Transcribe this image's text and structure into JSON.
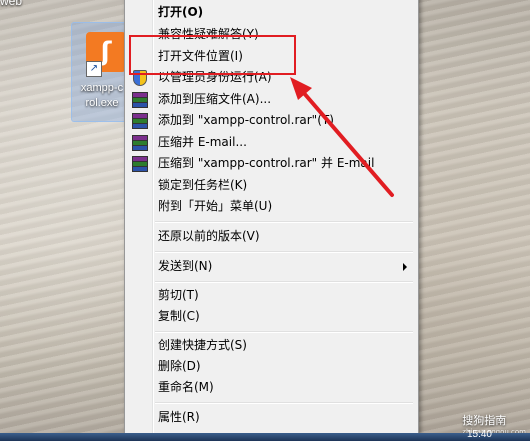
{
  "desktop": {
    "partial_label_top": "web",
    "icon_label": "xampp-c\nrol.exe",
    "icon_letter": "ʃ"
  },
  "menu": {
    "items": [
      {
        "label": "打开(O)",
        "bold": true
      },
      {
        "label": "兼容性疑难解答(Y)"
      },
      {
        "label": "打开文件位置(I)"
      },
      {
        "label": "以管理员身份运行(A)"
      },
      {
        "label": "添加到压缩文件(A)..."
      },
      {
        "label": "添加到 \"xampp-control.rar\"(T)"
      },
      {
        "label": "压缩并 E-mail..."
      },
      {
        "label": "压缩到 \"xampp-control.rar\" 并 E-mail"
      },
      {
        "label": "锁定到任务栏(K)"
      },
      {
        "label": "附到「开始」菜单(U)"
      },
      {
        "label": "还原以前的版本(V)"
      },
      {
        "label": "发送到(N)"
      },
      {
        "label": "剪切(T)"
      },
      {
        "label": "复制(C)"
      },
      {
        "label": "创建快捷方式(S)"
      },
      {
        "label": "删除(D)"
      },
      {
        "label": "重命名(M)"
      },
      {
        "label": "属性(R)"
      }
    ]
  },
  "taskbar": {
    "clock": "15:40"
  },
  "watermark": {
    "text": "搜狗指南",
    "sub": "zhinan.sogou.com"
  },
  "colors": {
    "annotation": "#e11d22",
    "menu_bg": "#f0f0f0",
    "xampp_orange": "#f37a22"
  }
}
